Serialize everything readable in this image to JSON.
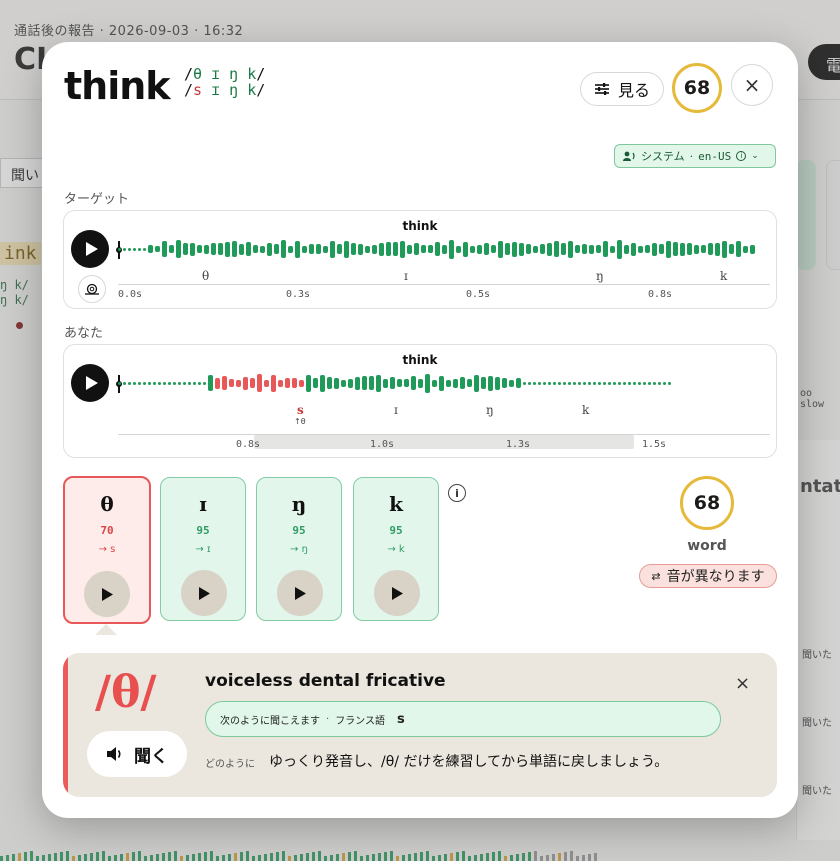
{
  "background": {
    "subtitle": "通話後の報告 · 2026-09-03 · 16:32",
    "title": "CI",
    "right_button": "電",
    "tab": "聞い",
    "word": "ink",
    "ipa_lines": [
      "ŋ k/",
      "ŋ k/"
    ],
    "side_labels": [
      "ntati",
      "聞いた",
      "聞いた",
      "聞いた",
      "oo slow"
    ]
  },
  "modal": {
    "word": "think",
    "ipa": {
      "target": [
        "/",
        "θ",
        " ɪ",
        " ŋ",
        " k",
        "/"
      ],
      "actual": [
        "/",
        "s",
        " ɪ",
        " ŋ",
        " k",
        "/"
      ]
    },
    "view_button": "見る",
    "score": "68",
    "close_icon": "×",
    "system_pill": {
      "label": "システム",
      "separator": "·",
      "value": "en-US"
    },
    "target_section": {
      "label": "ターゲット",
      "wave_title": "think",
      "phonemes": [
        "θ",
        "ɪ",
        "ŋ",
        "k"
      ],
      "ticks": [
        "0.0s",
        "0.3s",
        "0.5s",
        "0.8s"
      ]
    },
    "you_section": {
      "label": "あなた",
      "wave_title": "think",
      "phonemes": [
        "s",
        "ɪ",
        "ŋ",
        "k"
      ],
      "sub_note": "↑θ",
      "ticks": [
        "0.8s",
        "1.0s",
        "1.3s",
        "1.5s"
      ]
    },
    "phoneme_cards": [
      {
        "symbol": "θ",
        "score": "70",
        "heard": "→ s",
        "status": "bad"
      },
      {
        "symbol": "ɪ",
        "score": "95",
        "heard": "→ ɪ",
        "status": "good"
      },
      {
        "symbol": "ŋ",
        "score": "95",
        "heard": "→ ŋ",
        "status": "good"
      },
      {
        "symbol": "k",
        "score": "95",
        "heard": "→ k",
        "status": "good"
      }
    ],
    "info_icon": "i",
    "word_score": {
      "value": "68",
      "label": "word"
    },
    "diff_pill": "音が異なります",
    "detail": {
      "ipa": "/θ/",
      "listen_button": "聞く",
      "title": "voiceless dental fricative",
      "sounds_like_label": "次のように聞こえます",
      "sounds_like_sep": "·",
      "sounds_like_lang": "フランス語",
      "sounds_like_value": "s",
      "how_label": "どのように",
      "how_text": "ゆっくり発音し、/θ/ だけを練習してから単語に戻しましょう。",
      "close_icon": "×"
    }
  },
  "colors": {
    "good": "#1f9a58",
    "bad": "#e85858",
    "score_ring": "#e6b93a",
    "detail_bg": "#ebe7de"
  }
}
